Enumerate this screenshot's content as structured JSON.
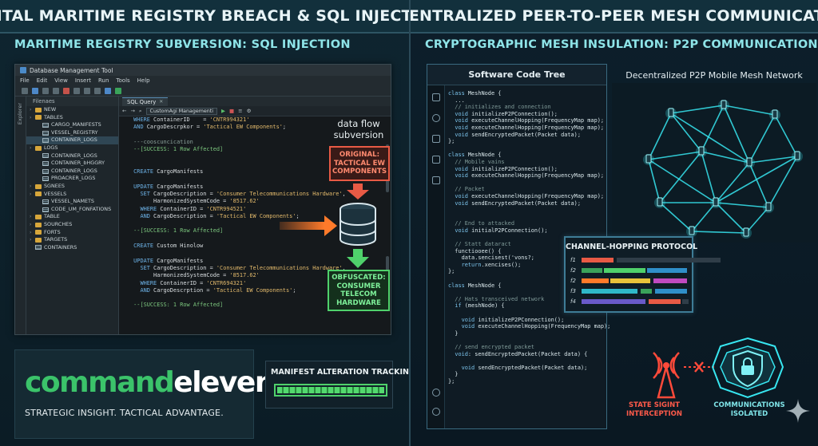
{
  "left": {
    "banner": "DIGITAL MARITIME REGISTRY BREACH & SQL INJECTION",
    "subhead": "MARITIME REGISTRY SUBVERSION: SQL INJECTION",
    "window": {
      "title": "Database Management Tool",
      "menu": [
        "File",
        "Edit",
        "View",
        "Insert",
        "Run",
        "Tools",
        "Help"
      ],
      "side_tab": "Explorer",
      "tree_header": "Filenaes",
      "tree": [
        {
          "label": "NEW",
          "type": "folder",
          "indent": 0
        },
        {
          "label": "TABLES",
          "type": "folder",
          "indent": 0
        },
        {
          "label": "CARGO_MANIFESTS",
          "type": "table",
          "indent": 1
        },
        {
          "label": "VESSEL_REGISTRY",
          "type": "table",
          "indent": 1
        },
        {
          "label": "CONTAINER_LOGS",
          "type": "table",
          "indent": 1,
          "selected": true
        },
        {
          "label": "LOGS",
          "type": "folder",
          "indent": 0
        },
        {
          "label": "CONTAINER_LOGS",
          "type": "table",
          "indent": 1
        },
        {
          "label": "CONTAINER_bHGGRY",
          "type": "table",
          "indent": 1
        },
        {
          "label": "CONTAINER_LOGS",
          "type": "table",
          "indent": 1
        },
        {
          "label": "PROACRER_LOGS",
          "type": "table",
          "indent": 1
        },
        {
          "label": "SGNEES",
          "type": "folder",
          "indent": 0
        },
        {
          "label": "VESSELS",
          "type": "folder",
          "indent": 0
        },
        {
          "label": "VESSEL_NAMETS",
          "type": "table",
          "indent": 1
        },
        {
          "label": "CODE_UM_FONFATIONS",
          "type": "table",
          "indent": 1
        },
        {
          "label": "TABLE",
          "type": "folder",
          "indent": 0
        },
        {
          "label": "SOURCHES",
          "type": "folder",
          "indent": 0
        },
        {
          "label": "FORTS",
          "type": "folder",
          "indent": 0
        },
        {
          "label": "TARGETS",
          "type": "folder",
          "indent": 0
        },
        {
          "label": "CONTAINERS",
          "type": "table",
          "indent": 0
        }
      ],
      "tab_label": "SQL Query",
      "dropdown": "CustomAgi Managementi",
      "code": [
        {
          "t": "pl",
          "s": " WHERE ContainerID    = 'CNTR994321'"
        },
        {
          "t": "pl",
          "s": " AND CargoDescrpkor = 'Tactical EW Components';"
        },
        {
          "t": "pl",
          "s": ""
        },
        {
          "t": "cm",
          "s": " ---cooscuncication"
        },
        {
          "t": "ok",
          "s": " --[SUCCESS: 1 Row Affected]"
        },
        {
          "t": "pl",
          "s": ""
        },
        {
          "t": "pl",
          "s": ""
        },
        {
          "t": "pl",
          "s": " CREATE CargoManifests"
        },
        {
          "t": "pl",
          "s": ""
        },
        {
          "t": "pl",
          "s": " UPDATE CargoManifests"
        },
        {
          "t": "pl",
          "s": "   SET CargoDescription = 'Consumer Telecommunications Hardware',"
        },
        {
          "t": "pl",
          "s": "       HarmonizedSystemCode = '8517.62'"
        },
        {
          "t": "pl",
          "s": "   WHERE ContainerID = 'CNTR994521'"
        },
        {
          "t": "pl",
          "s": "   AND CargoDescription = 'Tactical EW Components';"
        },
        {
          "t": "pl",
          "s": ""
        },
        {
          "t": "ok",
          "s": " --[SUCCESS: 1 Row Affected]"
        },
        {
          "t": "pl",
          "s": ""
        },
        {
          "t": "pl",
          "s": " CREATE Custom Hinolow"
        },
        {
          "t": "pl",
          "s": ""
        },
        {
          "t": "pl",
          "s": " UPDATE CargoManifests"
        },
        {
          "t": "pl",
          "s": "   SET CargoDescription = 'Consumer Telecommunications Hardware',"
        },
        {
          "t": "pl",
          "s": "       HarmonizedSystemCode = '8517.62'"
        },
        {
          "t": "pl",
          "s": "   WHERE ContainerID = 'CNTR694321'"
        },
        {
          "t": "pl",
          "s": "   AND CargoDescrption = 'Tactical EW Components';"
        },
        {
          "t": "pl",
          "s": ""
        },
        {
          "t": "ok",
          "s": " --[SUCCESS: 1 Row Affected]"
        }
      ]
    },
    "flow_label": "data flow\nsubversion",
    "original_box": "ORIGINAL:\nTACTICAL EW\nCOMPONENTS",
    "obfuscated_box": "OBFUSCATED:\nCONSUMER\nTELECOM\nHARDWARE",
    "logo": {
      "word1": "command",
      "word2": "eleven",
      "tagline": "STRATEGIC INSIGHT. TACTICAL ADVANTAGE."
    },
    "tracking": {
      "label": "MANIFEST ALTERATION TRACKING",
      "progress": 1.0
    }
  },
  "right": {
    "banner": "DECENTRALIZED PEER-TO-PEER MESH COMMUNICATION",
    "subhead": "CRYPTOGRAPHIC MESH INSULATION: P2P COMMUNICATION ISOLATION",
    "code_tree_title": "Software Code Tree",
    "code": [
      "class MeshNode {",
      "  ...",
      "  // initializes and connection",
      "  void initializeP2PConnection();",
      "  void executeChannelHopping(FrequencyMap map);",
      "  void executeChannelHopping(FrequencyMap map);",
      "  void sendEncryptedPacket(Packet data);",
      "};",
      "",
      "class MeshNode {",
      "  // Mobile vains",
      "  void initializeP2PConnection();",
      "  void executeChannelHopping(FrequencyMap map);",
      "",
      "  // Packet",
      "  void executeChannelHopping(FrequencyMap map);",
      "  void sendEncryptedPacket(Packet data);",
      "",
      "",
      "  // End to attacked",
      "  void initialP2PConnection();",
      "",
      "  // Statt dataract",
      "  functiooee() {",
      "    data.sencisest('vons?;",
      "    return.xencises();",
      "};",
      "",
      "class MeshNode {",
      "",
      "  // Hats transceived network",
      "  if (meshNode) {",
      "",
      "    void initializeP2PConnection();",
      "    void executeChannelHopping(FrequencyMap map);",
      "  }",
      "",
      "  // send encrypted packet",
      "  void: sendEncryptedPacket(Packet data) {",
      "",
      "    void sendEncryptedPacket(Packet data);",
      "  }",
      "};"
    ],
    "mesh_title": "Decentralized P2P Mobile Mesh Network",
    "hopping_title": "CHANNEL-HOPPING PROTOCOL",
    "hopping_rows": [
      "f1",
      "f2",
      "f2",
      "f3",
      "f4"
    ],
    "state_label": "STATE SIGINT\nINTERCEPTION",
    "iso_label": "COMMUNICATIONS\nISOLATED",
    "colors": {
      "cyan": "#37e6f0",
      "red": "#ff4a3a",
      "green": "#4fd16b",
      "orange": "#ff8a3a"
    }
  }
}
